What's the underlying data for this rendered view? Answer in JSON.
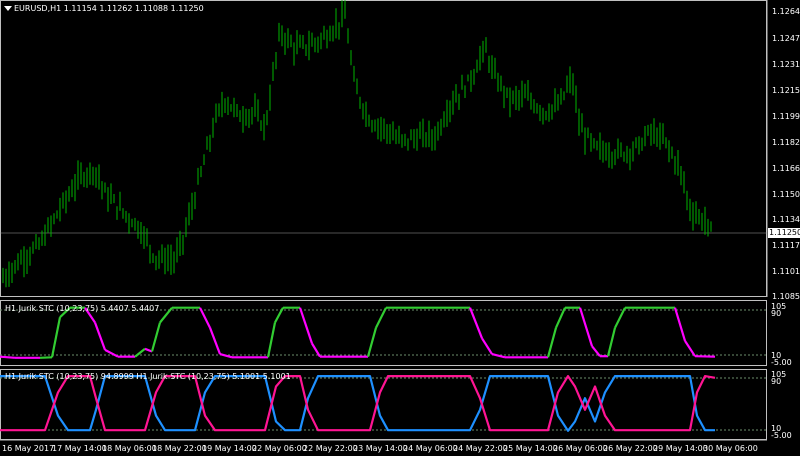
{
  "header": {
    "symbol_timeframe": "EURUSD,H1",
    "ohlc": "1.11154 1.11262 1.11088 1.11250"
  },
  "price_axis": {
    "ticks": [
      "1.12643",
      "1.12476",
      "1.12310",
      "1.12154",
      "1.11993",
      "1.11826",
      "1.11665",
      "1.11504",
      "1.11343",
      "1.11178",
      "1.11018",
      "1.10853"
    ],
    "current_price": "1.11250"
  },
  "panel1": {
    "title": "H1 Jurik STC (10,23,75) 5.4407 5.4407",
    "scale_labels": [
      "105",
      "90",
      "10",
      "-5.00"
    ]
  },
  "panel2": {
    "title": "H1 Jurik STC (10,23,75) 94.8999  H1 Jurik STC (10,23,75) 5.1001 5.1001",
    "scale_labels": [
      "105",
      "90",
      "10",
      "-5.00"
    ]
  },
  "time_axis": {
    "labels": [
      "16 May 2017",
      "17 May 14:00",
      "18 May 06:00",
      "18 May 22:00",
      "19 May 14:00",
      "22 May 06:00",
      "22 May 22:00",
      "23 May 14:00",
      "24 May 06:00",
      "24 May 22:00",
      "25 May 14:00",
      "26 May 06:00",
      "26 May 22:00",
      "29 May 14:00",
      "30 May 06:00"
    ]
  },
  "colors": {
    "background": "#000000",
    "candles": "#00b400",
    "stc_up": "#32cd32",
    "stc_down": "#ff00ff",
    "stc2_a": "#1e90ff",
    "stc2_b": "#ff1493",
    "grid_level": "#6b8e6b"
  },
  "chart_data": {
    "type": "line",
    "price_path": [
      [
        0,
        1.1095
      ],
      [
        20,
        1.1108
      ],
      [
        40,
        1.1118
      ],
      [
        60,
        1.114
      ],
      [
        80,
        1.116
      ],
      [
        95,
        1.1165
      ],
      [
        105,
        1.115
      ],
      [
        120,
        1.114
      ],
      [
        140,
        1.1128
      ],
      [
        155,
        1.111
      ],
      [
        175,
        1.1108
      ],
      [
        185,
        1.1125
      ],
      [
        200,
        1.116
      ],
      [
        215,
        1.1195
      ],
      [
        225,
        1.1208
      ],
      [
        240,
        1.1198
      ],
      [
        255,
        1.12
      ],
      [
        265,
        1.119
      ],
      [
        280,
        1.125
      ],
      [
        295,
        1.124
      ],
      [
        310,
        1.1242
      ],
      [
        320,
        1.1245
      ],
      [
        330,
        1.125
      ],
      [
        345,
        1.126
      ],
      [
        355,
        1.1215
      ],
      [
        370,
        1.1195
      ],
      [
        385,
        1.119
      ],
      [
        400,
        1.1182
      ],
      [
        420,
        1.1185
      ],
      [
        435,
        1.1185
      ],
      [
        450,
        1.1205
      ],
      [
        470,
        1.122
      ],
      [
        485,
        1.124
      ],
      [
        495,
        1.1222
      ],
      [
        510,
        1.1208
      ],
      [
        525,
        1.121
      ],
      [
        545,
        1.12
      ],
      [
        560,
        1.1205
      ],
      [
        572,
        1.1222
      ],
      [
        580,
        1.119
      ],
      [
        595,
        1.1178
      ],
      [
        610,
        1.1175
      ],
      [
        625,
        1.1175
      ],
      [
        640,
        1.118
      ],
      [
        650,
        1.1188
      ],
      [
        665,
        1.1182
      ],
      [
        680,
        1.1165
      ],
      [
        690,
        1.114
      ],
      [
        705,
        1.1132
      ],
      [
        712,
        1.1125
      ]
    ],
    "stc1": [
      [
        0,
        5
      ],
      [
        15,
        3
      ],
      [
        40,
        3
      ],
      [
        52,
        4
      ],
      [
        60,
        80
      ],
      [
        70,
        98
      ],
      [
        85,
        98
      ],
      [
        95,
        70
      ],
      [
        105,
        18
      ],
      [
        118,
        5
      ],
      [
        135,
        5
      ],
      [
        145,
        20
      ],
      [
        152,
        15
      ],
      [
        160,
        70
      ],
      [
        172,
        98
      ],
      [
        200,
        98
      ],
      [
        210,
        60
      ],
      [
        220,
        10
      ],
      [
        232,
        4
      ],
      [
        268,
        4
      ],
      [
        275,
        70
      ],
      [
        283,
        98
      ],
      [
        300,
        98
      ],
      [
        312,
        30
      ],
      [
        320,
        5
      ],
      [
        368,
        5
      ],
      [
        376,
        60
      ],
      [
        386,
        98
      ],
      [
        470,
        98
      ],
      [
        482,
        40
      ],
      [
        492,
        10
      ],
      [
        505,
        4
      ],
      [
        548,
        4
      ],
      [
        556,
        60
      ],
      [
        565,
        98
      ],
      [
        580,
        98
      ],
      [
        592,
        25
      ],
      [
        600,
        6
      ],
      [
        608,
        6
      ],
      [
        615,
        60
      ],
      [
        625,
        98
      ],
      [
        675,
        98
      ],
      [
        685,
        35
      ],
      [
        695,
        6
      ],
      [
        715,
        5
      ]
    ],
    "stc2_a": [
      [
        0,
        98
      ],
      [
        45,
        98
      ],
      [
        58,
        30
      ],
      [
        68,
        5
      ],
      [
        90,
        5
      ],
      [
        96,
        40
      ],
      [
        105,
        98
      ],
      [
        145,
        98
      ],
      [
        156,
        30
      ],
      [
        165,
        5
      ],
      [
        195,
        5
      ],
      [
        205,
        70
      ],
      [
        215,
        98
      ],
      [
        265,
        98
      ],
      [
        276,
        20
      ],
      [
        285,
        5
      ],
      [
        300,
        5
      ],
      [
        308,
        60
      ],
      [
        318,
        98
      ],
      [
        370,
        98
      ],
      [
        380,
        30
      ],
      [
        388,
        5
      ],
      [
        470,
        5
      ],
      [
        480,
        40
      ],
      [
        490,
        98
      ],
      [
        548,
        98
      ],
      [
        558,
        30
      ],
      [
        568,
        4
      ],
      [
        575,
        20
      ],
      [
        585,
        60
      ],
      [
        595,
        20
      ],
      [
        605,
        70
      ],
      [
        615,
        98
      ],
      [
        690,
        98
      ],
      [
        697,
        30
      ],
      [
        705,
        5
      ],
      [
        715,
        5
      ]
    ],
    "stc2_b": [
      [
        0,
        5
      ],
      [
        45,
        5
      ],
      [
        58,
        70
      ],
      [
        68,
        98
      ],
      [
        90,
        98
      ],
      [
        96,
        60
      ],
      [
        105,
        5
      ],
      [
        145,
        5
      ],
      [
        156,
        70
      ],
      [
        165,
        98
      ],
      [
        195,
        98
      ],
      [
        205,
        30
      ],
      [
        215,
        5
      ],
      [
        265,
        5
      ],
      [
        276,
        80
      ],
      [
        285,
        98
      ],
      [
        300,
        98
      ],
      [
        308,
        40
      ],
      [
        318,
        5
      ],
      [
        370,
        5
      ],
      [
        380,
        70
      ],
      [
        388,
        98
      ],
      [
        470,
        98
      ],
      [
        480,
        60
      ],
      [
        490,
        5
      ],
      [
        548,
        5
      ],
      [
        558,
        70
      ],
      [
        568,
        98
      ],
      [
        575,
        80
      ],
      [
        585,
        40
      ],
      [
        595,
        80
      ],
      [
        605,
        30
      ],
      [
        615,
        5
      ],
      [
        690,
        5
      ],
      [
        697,
        70
      ],
      [
        705,
        98
      ],
      [
        715,
        95
      ]
    ],
    "ylim_price": [
      1.10853,
      1.12643
    ],
    "ylim_stc": [
      -5,
      105
    ]
  }
}
